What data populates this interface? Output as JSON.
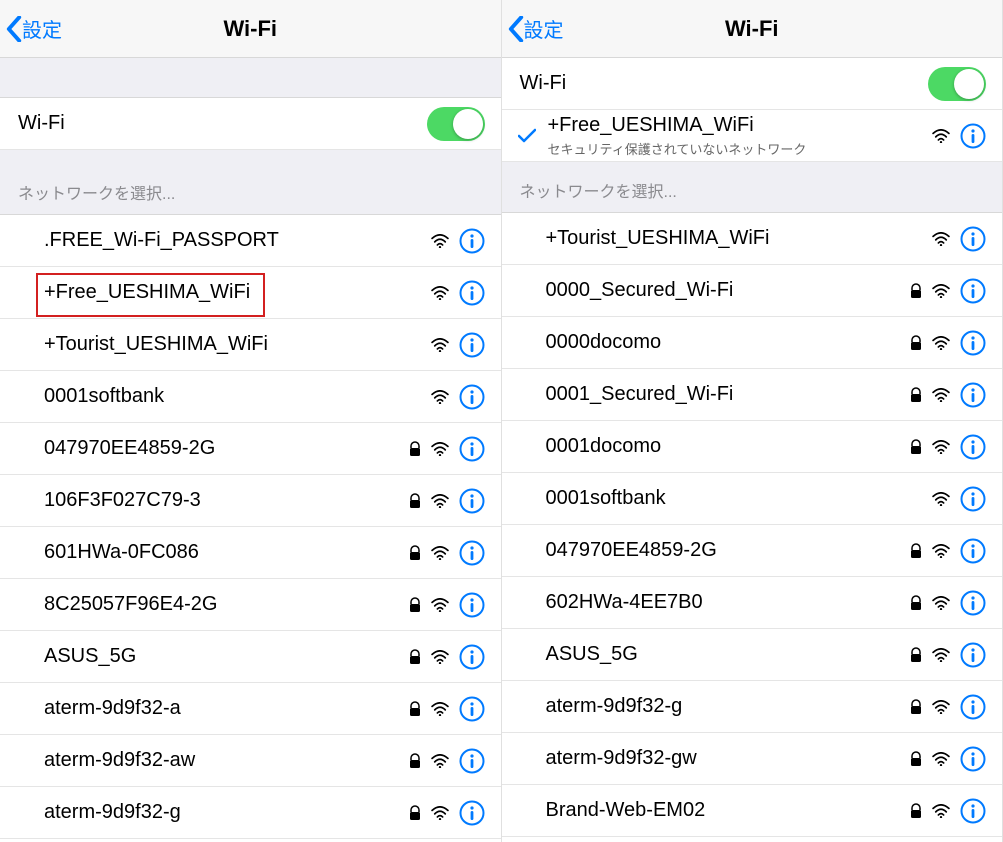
{
  "left": {
    "back_label": "設定",
    "title": "Wi-Fi",
    "wifi_label": "Wi-Fi",
    "select_header": "ネットワークを選択...",
    "networks": [
      {
        "name": ".FREE_Wi-Fi_PASSPORT",
        "locked": false
      },
      {
        "name": "+Free_UESHIMA_WiFi",
        "locked": false,
        "highlight": true
      },
      {
        "name": "+Tourist_UESHIMA_WiFi",
        "locked": false
      },
      {
        "name": "0001softbank",
        "locked": false
      },
      {
        "name": "047970EE4859-2G",
        "locked": true
      },
      {
        "name": "106F3F027C79-3",
        "locked": true
      },
      {
        "name": "601HWa-0FC086",
        "locked": true
      },
      {
        "name": "8C25057F96E4-2G",
        "locked": true
      },
      {
        "name": "ASUS_5G",
        "locked": true
      },
      {
        "name": "aterm-9d9f32-a",
        "locked": true
      },
      {
        "name": "aterm-9d9f32-aw",
        "locked": true
      },
      {
        "name": "aterm-9d9f32-g",
        "locked": true
      }
    ]
  },
  "right": {
    "back_label": "設定",
    "title": "Wi-Fi",
    "wifi_label": "Wi-Fi",
    "connected": {
      "name": "+Free_UESHIMA_WiFi",
      "note": "セキュリティ保護されていないネットワーク"
    },
    "select_header": "ネットワークを選択...",
    "networks": [
      {
        "name": "+Tourist_UESHIMA_WiFi",
        "locked": false
      },
      {
        "name": "0000_Secured_Wi-Fi",
        "locked": true
      },
      {
        "name": "0000docomo",
        "locked": true
      },
      {
        "name": "0001_Secured_Wi-Fi",
        "locked": true
      },
      {
        "name": "0001docomo",
        "locked": true
      },
      {
        "name": "0001softbank",
        "locked": false
      },
      {
        "name": "047970EE4859-2G",
        "locked": true
      },
      {
        "name": "602HWa-4EE7B0",
        "locked": true
      },
      {
        "name": "ASUS_5G",
        "locked": true
      },
      {
        "name": "aterm-9d9f32-g",
        "locked": true
      },
      {
        "name": "aterm-9d9f32-gw",
        "locked": true
      },
      {
        "name": "Brand-Web-EM02",
        "locked": true
      }
    ]
  }
}
